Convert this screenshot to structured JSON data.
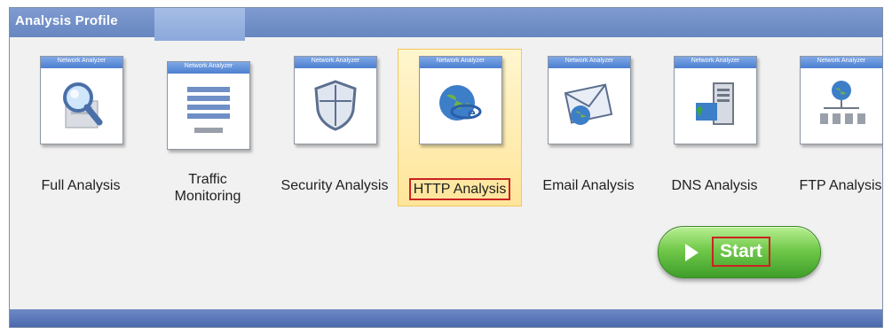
{
  "header": {
    "title": "Analysis Profile"
  },
  "tiles": [
    {
      "label": "Full Analysis",
      "doc_title": "Network Analyzer",
      "icon": "magnifier-icon",
      "selected": false
    },
    {
      "label_line1": "Traffic",
      "label_line2": "Monitoring",
      "doc_title": "Network Analyzer",
      "icon": "traffic-monitor-icon",
      "selected": false
    },
    {
      "label": "Security Analysis",
      "doc_title": "Network Analyzer",
      "icon": "shield-icon",
      "selected": false
    },
    {
      "label": "HTTP Analysis",
      "doc_title": "Network Analyzer",
      "icon": "http-globe-icon",
      "selected": true
    },
    {
      "label": "Email Analysis",
      "doc_title": "Network Analyzer",
      "icon": "envelope-icon",
      "selected": false
    },
    {
      "label": "DNS Analysis",
      "doc_title": "Network Analyzer",
      "icon": "dns-server-icon",
      "selected": false
    },
    {
      "label": "FTP Analysis",
      "doc_title": "Network Analyzer",
      "icon": "ftp-network-icon",
      "selected": false
    }
  ],
  "start_button": {
    "label": "Start"
  },
  "colors": {
    "header": "#7090c8",
    "selected_tile": "#ffe59a",
    "highlight": "#cc2222",
    "start_green": "#5fb83a"
  }
}
